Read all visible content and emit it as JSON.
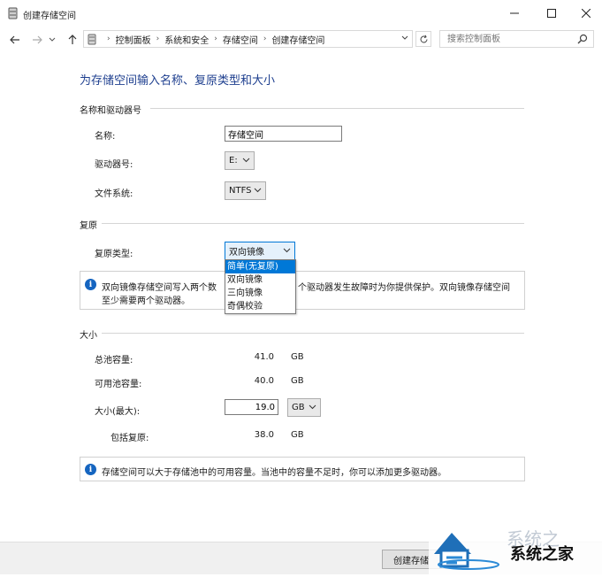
{
  "window": {
    "title": "创建存储空间",
    "icon": "storage-drive-icon",
    "controls": [
      "minimize-icon",
      "maximize-icon",
      "close-icon"
    ]
  },
  "nav": {
    "back_icon": "arrow-left-icon",
    "forward_icon": "arrow-right-icon",
    "up_icon": "arrow-up-icon",
    "breadcrumb": [
      "控制面板",
      "系统和安全",
      "存储空间",
      "创建存储空间"
    ],
    "refresh_icon": "refresh-icon",
    "search_placeholder": "搜索控制面板"
  },
  "page": {
    "heading": "为存储空间输入名称、复原类型和大小"
  },
  "name_section": {
    "label": "名称和驱动器号",
    "name_label": "名称:",
    "name_value": "存储空间",
    "drive_label": "驱动器号:",
    "drive_value": "E:",
    "fs_label": "文件系统:",
    "fs_value": "NTFS"
  },
  "resiliency_section": {
    "label": "复原",
    "type_label": "复原类型:",
    "type_value": "双向镜像",
    "options": [
      "简单(无复原)",
      "双向镜像",
      "三向镜像",
      "奇偶校验"
    ],
    "info_left": "双向镜像存储空间写入两个数",
    "info_right": "个驱动器发生故障时为你提供保护。双向镜像存储空间",
    "info_line2": "至少需要两个驱动器。"
  },
  "size_section": {
    "label": "大小",
    "total_label": "总池容量:",
    "total_value": "41.0",
    "total_unit": "GB",
    "avail_label": "可用池容量:",
    "avail_value": "40.0",
    "avail_unit": "GB",
    "size_label": "大小(最大):",
    "size_value": "19.0",
    "size_unit": "GB",
    "incl_label": "包括复原:",
    "incl_value": "38.0",
    "incl_unit": "GB",
    "info": "存储空间可以大于存储池中的可用容量。当池中的容量不足时，你可以添加更多驱动器。"
  },
  "footer": {
    "create_button": "创建存储"
  },
  "watermark": {
    "text": "系统之家"
  },
  "colors": {
    "heading": "#1e3f8f",
    "info_icon": "#1565c0",
    "selection": "#0078d7"
  }
}
